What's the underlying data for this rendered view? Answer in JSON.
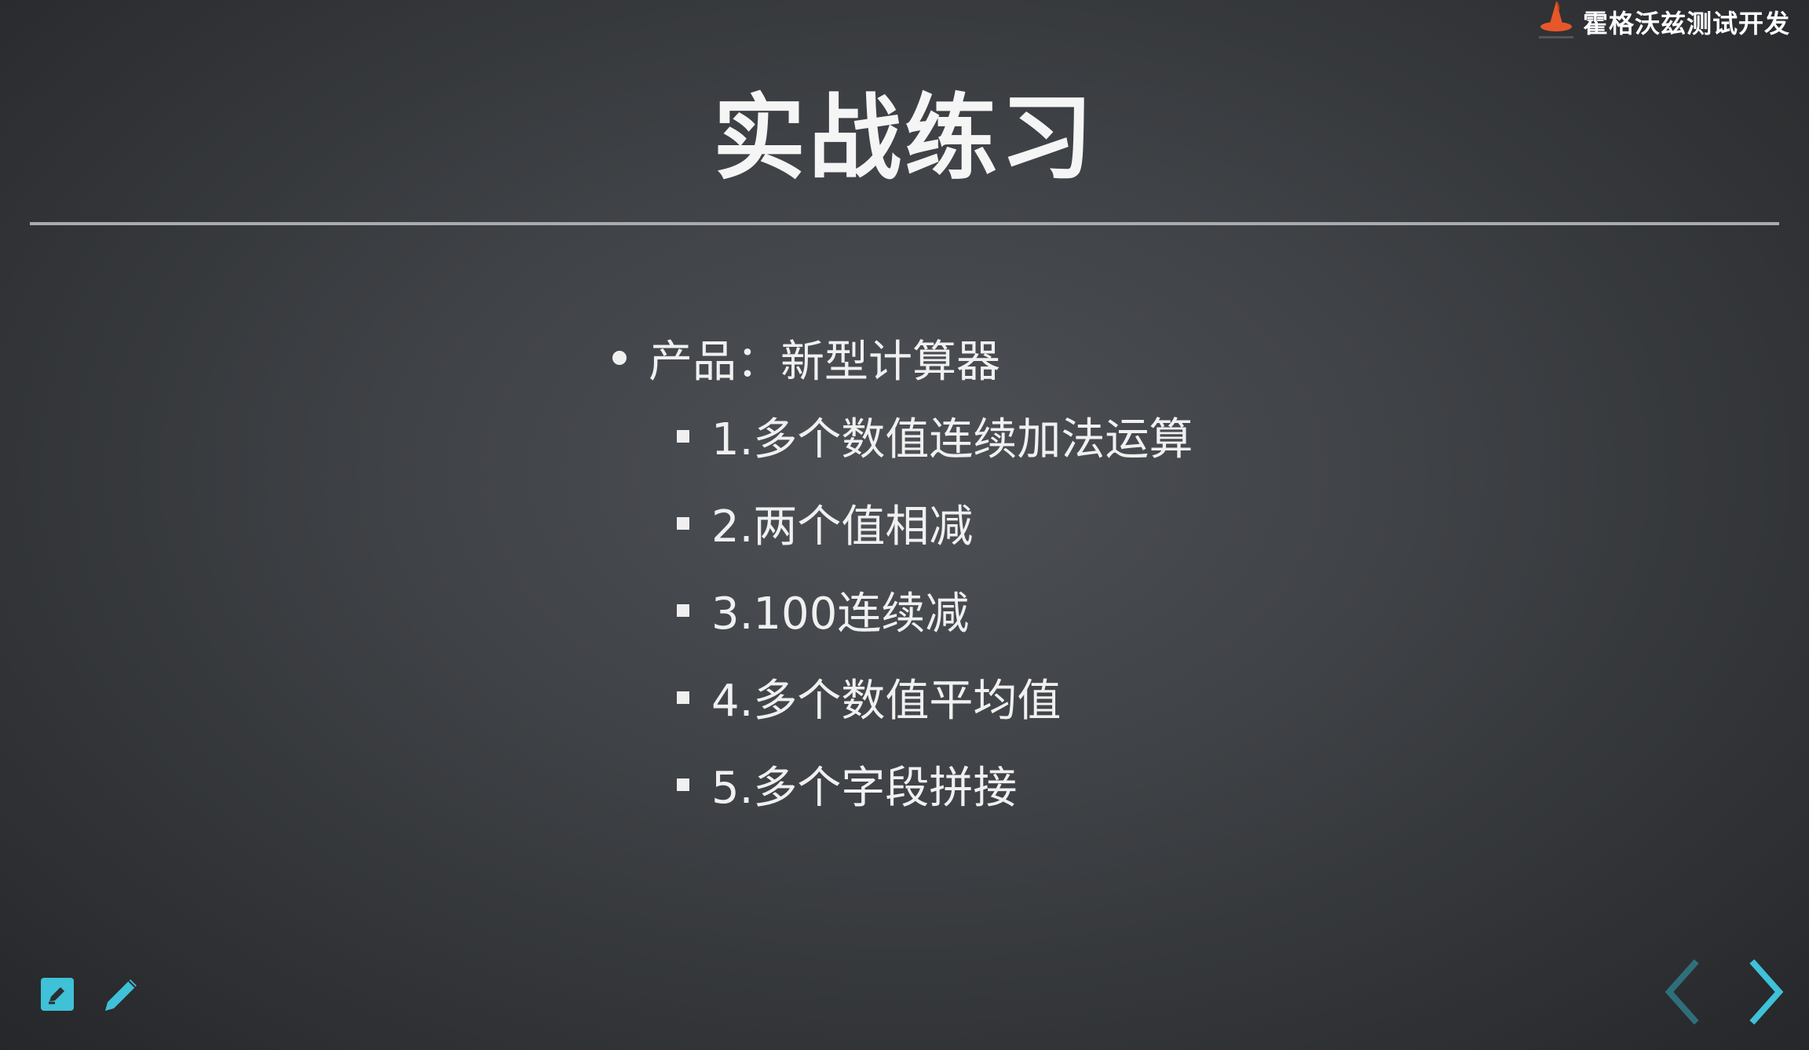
{
  "brand": {
    "name": "霍格沃兹测试开发",
    "logo_icon": "wizard-hat-icon",
    "accent_color": "#e8572a"
  },
  "slide": {
    "title": "实战练习",
    "bullet": "产品：新型计算器",
    "subitems": [
      "1.多个数值连续加法运算",
      "2.两个值相减",
      "3.100连续减",
      "4.多个数值平均值",
      "5.多个字段拼接"
    ]
  },
  "controls": {
    "edit_icon": "edit-note-icon",
    "pen_icon": "pencil-icon",
    "prev_icon": "chevron-left-icon",
    "next_icon": "chevron-right-icon",
    "control_color": "#3fc1d8",
    "disabled_color": "#2f6f7a"
  }
}
